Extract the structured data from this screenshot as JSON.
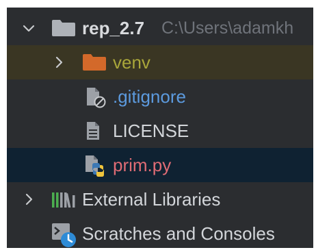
{
  "tree": {
    "project": {
      "name": "rep_2.7",
      "path": "C:\\Users\\adamkh",
      "expanded": true,
      "icon": "folder-icon"
    },
    "items": [
      {
        "label": "venv",
        "icon": "folder-icon",
        "kind": "folder",
        "expanded": false,
        "color": "#a9a63a",
        "icon_color": "#d3692a"
      },
      {
        "label": ".gitignore",
        "icon": "ignored-file-icon",
        "kind": "file",
        "color": "#5c9ade"
      },
      {
        "label": "LICENSE",
        "icon": "text-file-icon",
        "kind": "file",
        "color": "#d3d6da"
      },
      {
        "label": "prim.py",
        "icon": "python-file-icon",
        "kind": "file",
        "color": "#e06c75",
        "selected": true
      }
    ],
    "external_libraries": {
      "label": "External Libraries",
      "icon": "library-icon",
      "expanded": false
    },
    "scratches": {
      "label": "Scratches and Consoles",
      "icon": "scratches-icon"
    }
  },
  "colors": {
    "background": "#2b2d30",
    "venv_row_background": "#3a3623",
    "selected_row_background": "#0f2232",
    "path_text": "#6f737a"
  }
}
